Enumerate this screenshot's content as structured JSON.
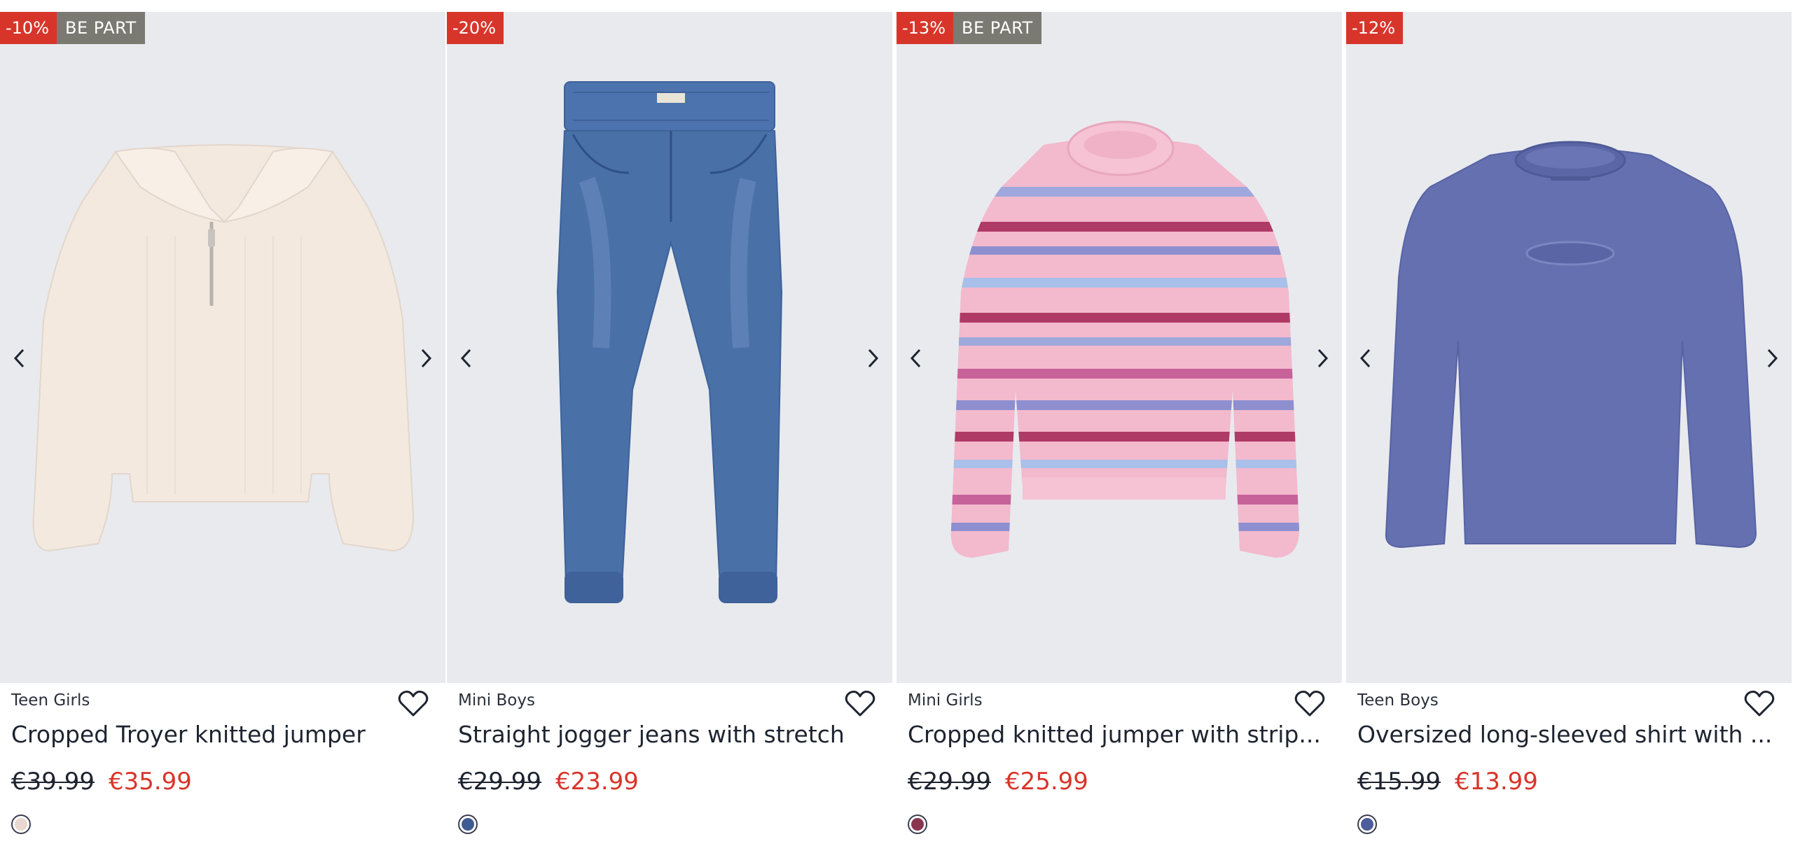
{
  "products": [
    {
      "discount": "-10%",
      "badge": "BE PART",
      "category": "Teen Girls",
      "title": "Cropped Troyer knitted jumper",
      "old_price": "€39.99",
      "new_price": "€35.99",
      "swatch_color": "#e8d8d0",
      "product_color": "#f3e9df"
    },
    {
      "discount": "-20%",
      "badge": "",
      "category": "Mini Boys",
      "title": "Straight jogger jeans with stretch",
      "old_price": "€29.99",
      "new_price": "€23.99",
      "swatch_color": "#3f5c92",
      "product_color": "#4a70a8"
    },
    {
      "discount": "-13%",
      "badge": "BE PART",
      "category": "Mini Girls",
      "title": "Cropped knitted jumper with strip...",
      "old_price": "€29.99",
      "new_price": "€25.99",
      "swatch_color": "#8a3550",
      "product_color": "#f3b9cc"
    },
    {
      "discount": "-12%",
      "badge": "",
      "category": "Teen Boys",
      "title": "Oversized long-sleeved shirt with ...",
      "old_price": "€15.99",
      "new_price": "€13.99",
      "swatch_color": "#4c5c9c",
      "product_color": "#6570b0"
    }
  ],
  "icons": {
    "prev": "chevron-left-icon",
    "next": "chevron-right-icon",
    "wishlist": "heart-outline-icon"
  },
  "colors": {
    "discount_badge": "#d8352a",
    "bepart_badge": "#7a7a72",
    "sale_price": "#d8352a",
    "image_background": "#e8eaee"
  }
}
